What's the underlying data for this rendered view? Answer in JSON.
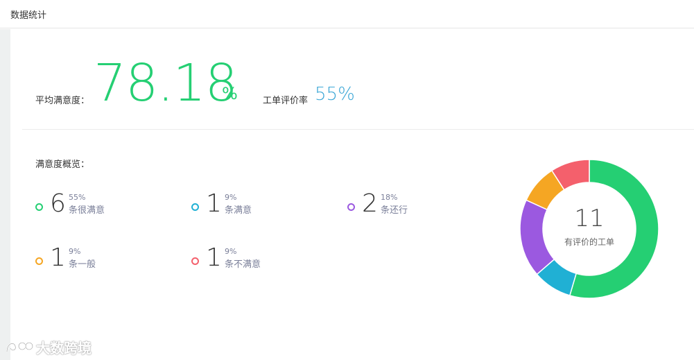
{
  "header": {
    "title": "数据统计"
  },
  "summary": {
    "avg_label": "平均满意度：",
    "avg_value": "78.18",
    "avg_unit": "%",
    "rate_label": "工单评价率",
    "rate_value": "55%"
  },
  "overview": {
    "title": "满意度概览：",
    "items": [
      {
        "count": "6",
        "percent": "55%",
        "label": "条很满意",
        "color": "#25cf73"
      },
      {
        "count": "1",
        "percent": "9%",
        "label": "条满意",
        "color": "#20b0d4"
      },
      {
        "count": "2",
        "percent": "18%",
        "label": "条还行",
        "color": "#9b59e0"
      },
      {
        "count": "1",
        "percent": "9%",
        "label": "条一般",
        "color": "#f5a623"
      },
      {
        "count": "1",
        "percent": "9%",
        "label": "条不满意",
        "color": "#f4606c"
      }
    ]
  },
  "donut": {
    "total": "11",
    "caption": "有评价的工单",
    "segments": [
      {
        "name": "很满意",
        "value": 6,
        "color": "#25cf73"
      },
      {
        "name": "满意",
        "value": 1,
        "color": "#20b0d4"
      },
      {
        "name": "还行",
        "value": 2,
        "color": "#9b59e0"
      },
      {
        "name": "一般",
        "value": 1,
        "color": "#f5a623"
      },
      {
        "name": "不满意",
        "value": 1,
        "color": "#f4606c"
      }
    ]
  },
  "watermark": {
    "text": "大数跨境"
  }
}
